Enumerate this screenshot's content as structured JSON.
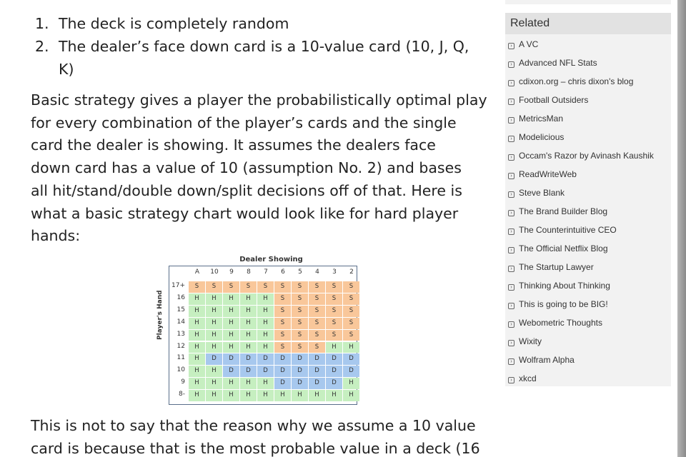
{
  "article": {
    "list": [
      {
        "num": "1.",
        "text": "The deck is completely random"
      },
      {
        "num": "2.",
        "text": "The dealer’s face down card is a 10-value card (10, J, Q,",
        "text2": "K)"
      }
    ],
    "para1_lines": [
      "Basic strategy gives a player the probabilistically optimal play",
      "for every combination of the player’s cards and the single",
      "card the dealer is showing.  It assumes the dealers face",
      "down card has a value of 10 (assumption No. 2) and bases",
      "all hit/stand/double down/split decisions off of that.  Here is",
      "what a basic strategy chart would look like for hard player",
      "hands:"
    ],
    "para2_lines": [
      "This is not to say that the reason why we assume a 10 value",
      "card is because that is the most probable value in a deck (16"
    ]
  },
  "chart_data": {
    "type": "table",
    "title": "Dealer Showing",
    "ylabel": "Player's Hand",
    "columns": [
      "A",
      "10",
      "9",
      "8",
      "7",
      "6",
      "5",
      "4",
      "3",
      "2"
    ],
    "rows": [
      "17+",
      "16",
      "15",
      "14",
      "13",
      "12",
      "11",
      "10",
      "9",
      "8-"
    ],
    "cells": [
      [
        "S",
        "S",
        "S",
        "S",
        "S",
        "S",
        "S",
        "S",
        "S",
        "S"
      ],
      [
        "H",
        "H",
        "H",
        "H",
        "H",
        "S",
        "S",
        "S",
        "S",
        "S"
      ],
      [
        "H",
        "H",
        "H",
        "H",
        "H",
        "S",
        "S",
        "S",
        "S",
        "S"
      ],
      [
        "H",
        "H",
        "H",
        "H",
        "H",
        "S",
        "S",
        "S",
        "S",
        "S"
      ],
      [
        "H",
        "H",
        "H",
        "H",
        "H",
        "S",
        "S",
        "S",
        "S",
        "S"
      ],
      [
        "H",
        "H",
        "H",
        "H",
        "H",
        "S",
        "S",
        "S",
        "H",
        "H"
      ],
      [
        "H",
        "D",
        "D",
        "D",
        "D",
        "D",
        "D",
        "D",
        "D",
        "D"
      ],
      [
        "H",
        "H",
        "D",
        "D",
        "D",
        "D",
        "D",
        "D",
        "D",
        "D"
      ],
      [
        "H",
        "H",
        "H",
        "H",
        "H",
        "D",
        "D",
        "D",
        "D",
        "H"
      ],
      [
        "H",
        "H",
        "H",
        "H",
        "H",
        "H",
        "H",
        "H",
        "H",
        "H"
      ]
    ],
    "colors": {
      "S": "#f9c79a",
      "H": "#c6efc0",
      "D": "#a7c8ee"
    }
  },
  "sidebar": {
    "title": "Related",
    "icon": "rss-icon",
    "items": [
      "A VC",
      "Advanced NFL Stats",
      "cdixon.org – chris dixon's blog",
      "Football Outsiders",
      "MetricsMan",
      "Modelicious",
      "Occam's Razor by Avinash Kaushik",
      "ReadWriteWeb",
      "Steve Blank",
      "The Brand Builder Blog",
      "The Counterintuitive CEO",
      "The Official Netflix Blog",
      "The Startup Lawyer",
      "Thinking About Thinking",
      "This is going to be BIG!",
      "Webometric Thoughts",
      "Wixity",
      "Wolfram Alpha",
      "xkcd"
    ]
  }
}
